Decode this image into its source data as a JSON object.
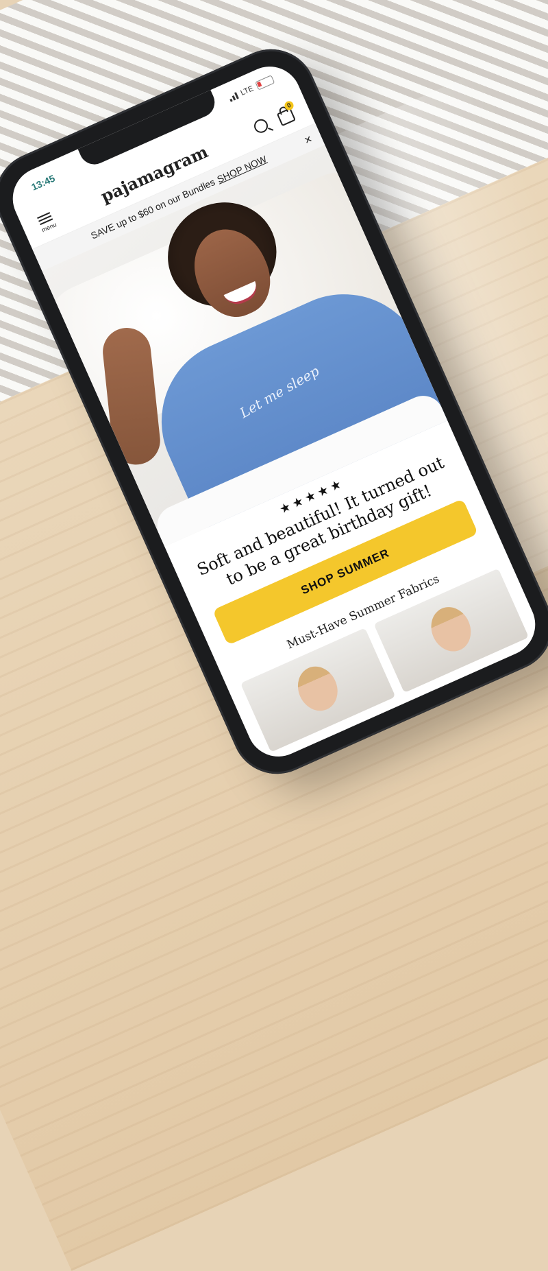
{
  "status_bar": {
    "time": "13:45",
    "network": "LTE"
  },
  "header": {
    "menu_label": "menu",
    "logo": "pajamagram",
    "cart_count": "0",
    "search_icon": "search-icon",
    "cart_icon": "shopping-bag-icon"
  },
  "promo": {
    "text": "SAVE up to $60 on our Bundles",
    "link": "SHOP NOW",
    "close": "×"
  },
  "hero": {
    "shirt_text": "Let me sleep"
  },
  "review": {
    "stars": "★★★★★",
    "rating": 5,
    "quote": "Soft and beautiful! It turned out to be a great birthday gift!"
  },
  "cta": {
    "label": "SHOP SUMMER"
  },
  "section": {
    "title": "Must-Have Summer Fabrics"
  },
  "colors": {
    "accent": "#f4c72c",
    "shirt": "#5b86c6",
    "status_text": "#2a7a78"
  }
}
